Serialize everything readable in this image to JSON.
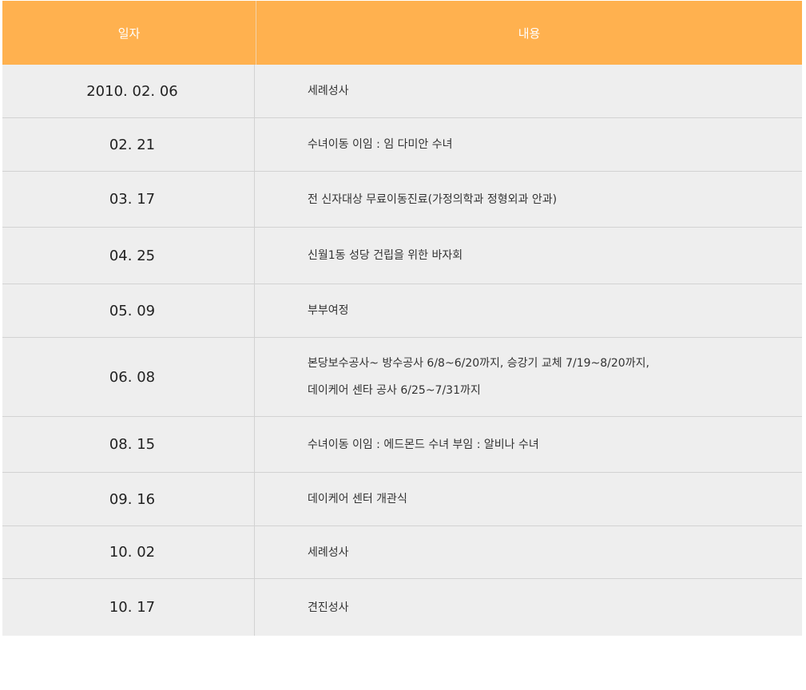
{
  "table": {
    "headers": {
      "date": "일자",
      "content": "내용"
    },
    "rows": [
      {
        "date": "2010. 02. 06",
        "lines": [
          "세례성사"
        ]
      },
      {
        "date": "02. 21",
        "lines": [
          "수녀이동  이임 : 임 다미안 수녀"
        ]
      },
      {
        "date": "03. 17",
        "lines": [
          "전 신자대상 무료이동진료(가정의학과 정형외과 안과)"
        ]
      },
      {
        "date": "04. 25",
        "lines": [
          "신월1동 성당 건립을 위한 바자회"
        ]
      },
      {
        "date": "05. 09",
        "lines": [
          "부부여정"
        ]
      },
      {
        "date": "06. 08",
        "lines": [
          "본당보수공사~  방수공사 6/8~6/20까지, 승강기 교체 7/19~8/20까지,",
          "데이케어 센타 공사 6/25~7/31까지"
        ]
      },
      {
        "date": "08. 15",
        "lines": [
          "수녀이동  이임 : 에드몬드 수녀   부임 : 알비나 수녀"
        ]
      },
      {
        "date": "09. 16",
        "lines": [
          "데이케어 센터 개관식"
        ]
      },
      {
        "date": "10. 02",
        "lines": [
          "세례성사"
        ]
      },
      {
        "date": "10. 17",
        "lines": [
          "견진성사"
        ]
      }
    ]
  },
  "colors": {
    "header_bg": "#ffb14f",
    "header_text": "#ffffff",
    "row_bg": "#eeeeee",
    "border": "#d2d2d2"
  }
}
